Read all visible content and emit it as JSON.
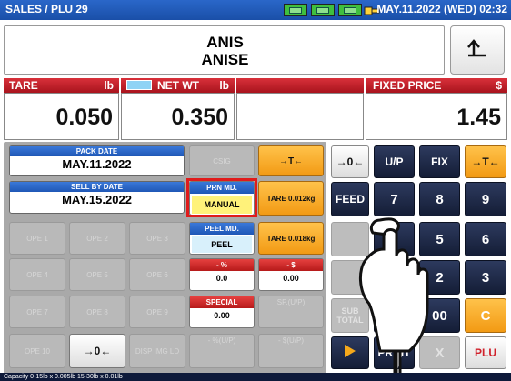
{
  "header": {
    "title": "SALES / PLU 29",
    "datetime": "MAY.11.2022 (WED) 02:32",
    "status_icons": [
      "display-icon",
      "display-icon",
      "display-icon",
      "connector-icon"
    ]
  },
  "item": {
    "name_line1": "ANIS",
    "name_line2": "ANISE",
    "back_icon": "return-arrow-icon"
  },
  "weights": {
    "tare_label": "TARE",
    "tare_unit": "lb",
    "tare_value": "0.050",
    "net_label": "NET WT",
    "net_unit": "lb",
    "net_value": "0.350",
    "fixed_label": "FIXED PRICE",
    "fixed_unit": "$",
    "fixed_value": "1.45"
  },
  "left": {
    "pack_date_label": "PACK DATE",
    "pack_date_value": "MAY.11.2022",
    "sell_by_label": "SELL BY DATE",
    "sell_by_value": "MAY.15.2022",
    "csig": "CSIG",
    "prn_label": "PRN MD.",
    "prn_value": "MANUAL",
    "peel_label": "PEEL MD.",
    "peel_value": "PEEL",
    "tare_btn_1": "TARE 0.012kg",
    "tare_btn_2": "TARE 0.018kg",
    "tare_key_label": "→T←",
    "zero_key_label": "→0←",
    "pct_label": "- %",
    "pct_value": "0.0",
    "dollar_label": "- $",
    "dollar_value": "0.00",
    "special_label": "SPECIAL",
    "special_value": "0.00",
    "sp_up_label": "SP.(U/P)",
    "minus_up_label": "- %(U/P)",
    "minus_dollar_up_label": "- $(U/P)",
    "ope": [
      "OPE 1",
      "OPE 2",
      "OPE 3",
      "OPE 4",
      "OPE 5",
      "OPE 6",
      "OPE 7",
      "OPE 8",
      "OPE 9",
      "OPE 10"
    ],
    "disp_img_label": "DISP IMG LD"
  },
  "keypad": {
    "zero_label": "→0←",
    "up_label": "U/P",
    "fix_label": "FIX",
    "tare_label": "→T←",
    "feed_label": "FEED",
    "seven": "7",
    "eight": "8",
    "nine": "9",
    "five": "5",
    "six": "6",
    "two": "2",
    "three": "3",
    "double_zero": "00",
    "clear": "C",
    "subtotal_label": "SUB TOTAL",
    "print_label": "PRINT",
    "x_label": "X",
    "plu_label": "PLU"
  },
  "footer": {
    "capacity": "Capacity 0-15lb x 0.005lb  15-30lb x 0.01lb"
  },
  "colors": {
    "header_blue": "#1f57b6",
    "accent_red": "#b61a1a",
    "accent_orange": "#f29a14",
    "keypad_dark": "#141d36",
    "highlight_red": "#e01b1b"
  }
}
